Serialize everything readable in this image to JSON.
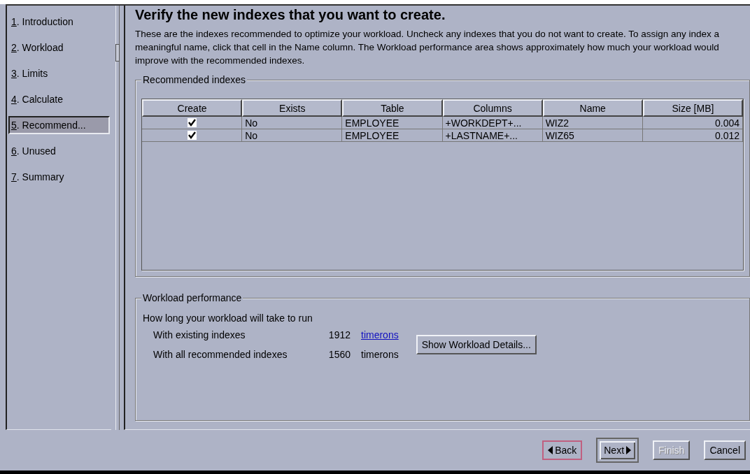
{
  "steps": [
    {
      "mnemonic": "1",
      "rest": ". Introduction",
      "selected": false
    },
    {
      "mnemonic": "2",
      "rest": ". Workload",
      "selected": false
    },
    {
      "mnemonic": "3",
      "rest": ". Limits",
      "selected": false
    },
    {
      "mnemonic": "4",
      "rest": ". Calculate",
      "selected": false
    },
    {
      "mnemonic": "5",
      "rest": ". Recommend...",
      "selected": true
    },
    {
      "mnemonic": "6",
      "rest": ". Unused",
      "selected": false
    },
    {
      "mnemonic": "7",
      "rest": ". Summary",
      "selected": false
    }
  ],
  "heading": "Verify the new indexes that you want to create.",
  "description": "These are the indexes recommended to optimize your workload. Uncheck any indexes that you do not want to create. To assign any index a meaningful name, click that cell in the Name column. The Workload performance area shows approximately how much your workload would improve with the recommended indexes.",
  "recommended": {
    "title": "Recommended indexes",
    "columns": [
      "Create",
      "Exists",
      "Table",
      "Columns",
      "Name",
      "Size [MB]"
    ],
    "rows": [
      {
        "create": true,
        "exists": "No",
        "table": "EMPLOYEE",
        "columns": "+WORKDEPT+...",
        "name": "WIZ2",
        "size": "0.004"
      },
      {
        "create": true,
        "exists": "No",
        "table": "EMPLOYEE",
        "columns": "+LASTNAME+...",
        "name": "WIZ65",
        "size": "0.012"
      }
    ]
  },
  "performance": {
    "title": "Workload performance",
    "intro": "How long your workload will take to run",
    "lines": [
      {
        "label": "With existing indexes",
        "value": "1912",
        "unit": "timerons",
        "link": true
      },
      {
        "label": "With all recommended indexes",
        "value": "1560",
        "unit": "timerons",
        "link": false
      }
    ],
    "details_button": "Show Workload Details..."
  },
  "buttons": [
    {
      "label": "Back",
      "kind": "back",
      "focused": true,
      "default": false,
      "disabled": false
    },
    {
      "label": "Next",
      "kind": "next",
      "focused": false,
      "default": true,
      "disabled": false
    },
    {
      "label": "Finish",
      "kind": "plain",
      "focused": false,
      "default": false,
      "disabled": true
    },
    {
      "label": "Cancel",
      "kind": "plain",
      "focused": false,
      "default": false,
      "disabled": false
    }
  ]
}
